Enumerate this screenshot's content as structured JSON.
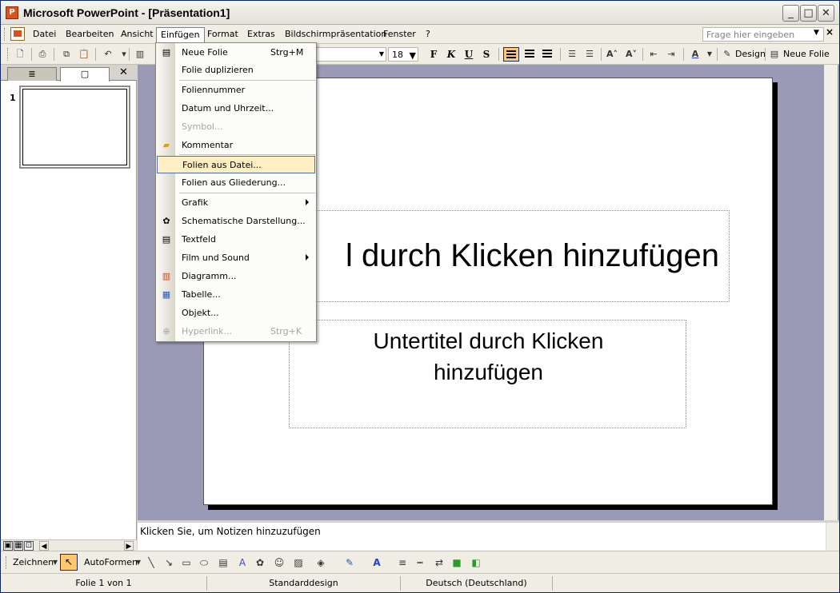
{
  "window": {
    "title": "Microsoft PowerPoint - [Präsentation1]",
    "app_icon": "P",
    "controls": {
      "minimize": "_",
      "maximize": "□",
      "close": "✕"
    }
  },
  "menubar": {
    "items": [
      "Datei",
      "Bearbeiten",
      "Ansicht",
      "Einfügen",
      "Format",
      "Extras",
      "Bildschirmpräsentation",
      "Fenster",
      "?"
    ],
    "active": "Einfügen",
    "help_placeholder": "Frage hier eingeben"
  },
  "toolbar": {
    "font_size": "18",
    "bold": "F",
    "italic": "K",
    "underline": "U",
    "shadow": "S",
    "design_label": "Design",
    "new_slide_label": "Neue Folie"
  },
  "left_pane": {
    "tab_outline": "≣",
    "tab_slides": "▢",
    "close": "✕",
    "slide_number": "1"
  },
  "slide": {
    "title": "l durch Klicken hinzufügen",
    "subtitle": "Untertitel durch Klicken hinzufügen"
  },
  "notes": {
    "placeholder": "Klicken Sie, um Notizen hinzuzufügen"
  },
  "drawbar": {
    "draw_label": "Zeichnen",
    "autoshapes_label": "AutoFormen"
  },
  "statusbar": {
    "slide_info": "Folie 1 von 1",
    "design": "Standarddesign",
    "language": "Deutsch (Deutschland)"
  },
  "dropdown": {
    "items": [
      {
        "label": "Neue Folie",
        "shortcut": "Strg+M"
      },
      {
        "label": "Folie duplizieren"
      },
      {
        "label": "Foliennummer"
      },
      {
        "label": "Datum und Uhrzeit..."
      },
      {
        "label": "Symbol..."
      },
      {
        "label": "Kommentar"
      },
      {
        "label": "Folien aus Datei..."
      },
      {
        "label": "Folien aus Gliederung..."
      },
      {
        "label": "Grafik"
      },
      {
        "label": "Schematische Darstellung..."
      },
      {
        "label": "Textfeld"
      },
      {
        "label": "Film und Sound"
      },
      {
        "label": "Diagramm..."
      },
      {
        "label": "Tabelle..."
      },
      {
        "label": "Objekt..."
      },
      {
        "label": "Hyperlink...",
        "shortcut": "Strg+K"
      }
    ]
  }
}
